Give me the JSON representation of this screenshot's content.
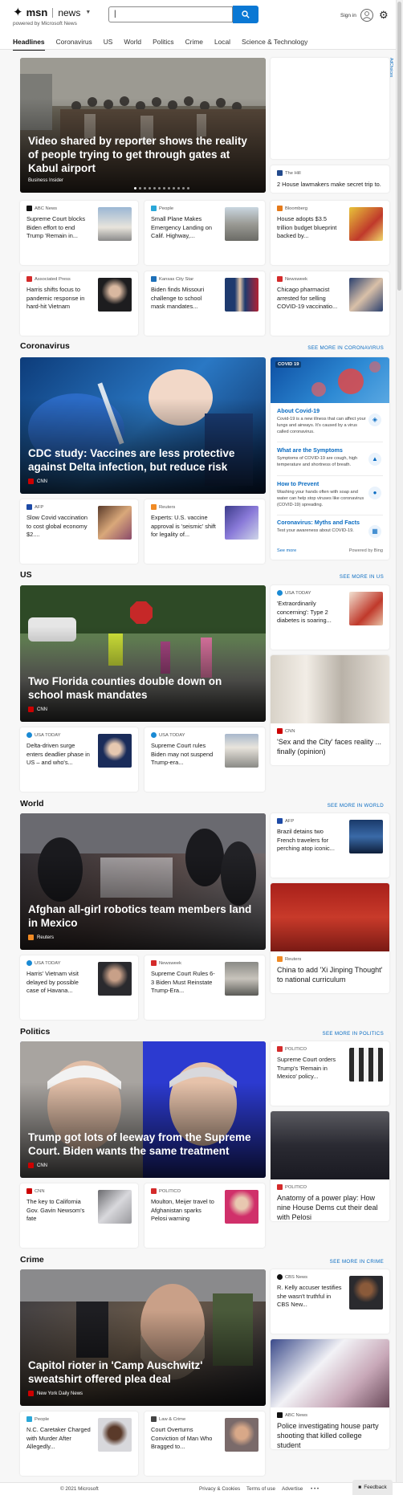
{
  "header": {
    "logo_msn": "msn",
    "logo_news": "news",
    "powered_by": "powered by Microsoft News",
    "search_value": "|",
    "signin_label": "Sign in"
  },
  "nav": [
    "Headlines",
    "Coronavirus",
    "US",
    "World",
    "Politics",
    "Crime",
    "Local",
    "Science & Technology"
  ],
  "adchoices": "AdChoices",
  "top": {
    "hero": {
      "title": "Video shared by reporter shows the reality of people trying to get through gates at Kabul airport",
      "source": "Business Insider"
    },
    "side": {
      "source": "The Hill",
      "title": "2 House lawmakers make secret trip to..."
    },
    "row1": [
      {
        "source": "ABC News",
        "title": "Supreme Court blocks Biden effort to end Trump 'Remain in..."
      },
      {
        "source": "People",
        "title": "Small Plane Makes Emergency Landing on Calif. Highway,..."
      },
      {
        "source": "Bloomberg",
        "title": "House adopts $3.5 trillion budget blueprint backed by..."
      }
    ],
    "row2": [
      {
        "source": "Associated Press",
        "title": "Harris shifts focus to pandemic response in hard-hit Vietnam"
      },
      {
        "source": "Kansas City Star",
        "title": "Biden finds Missouri challenge to school mask mandates..."
      },
      {
        "source": "Newsweek",
        "title": "Chicago pharmacist arrested for selling COVID-19 vaccinatio..."
      }
    ]
  },
  "coronavirus": {
    "title": "Coronavirus",
    "see_more": "SEE MORE IN CORONAVIRUS",
    "hero": {
      "title": "CDC study: Vaccines are less protective against Delta infection, but reduce risk",
      "source": "CNN"
    },
    "cards": [
      {
        "source": "AFP",
        "title": "Slow Covid vaccination to cost global economy $2...."
      },
      {
        "source": "Reuters",
        "title": "Experts: U.S. vaccine approval is 'seismic' shift for legality of..."
      }
    ],
    "module": {
      "tag": "COVID 19",
      "items": [
        {
          "title": "About Covid-19",
          "text": "Covid-19 is a new illness that can affect your lungs and airways. It's caused by a virus called coronavirus."
        },
        {
          "title": "What are the Symptoms",
          "text": "Symptoms of COVID-19 are cough, high temperature and shortness of breath."
        },
        {
          "title": "How to Prevent",
          "text": "Washing your hands often with soap and water can help stop viruses like coronavirus (COVID-19) spreading."
        },
        {
          "title": "Coronavirus: Myths and Facts",
          "text": "Test your awareness about COVID-19."
        }
      ],
      "see_more": "See more",
      "powered": "Powered by Bing"
    }
  },
  "us": {
    "title": "US",
    "see_more": "SEE MORE IN US",
    "hero": {
      "title": "Two Florida counties double down on school mask mandates",
      "source": "CNN"
    },
    "side": {
      "source": "USA TODAY",
      "title": "'Extraordinarily concerning': Type 2 diabetes is soaring..."
    },
    "tall": {
      "source": "CNN",
      "title": "'Sex and the City' faces reality ... finally (opinion)"
    },
    "cards": [
      {
        "source": "USA TODAY",
        "title": "Delta-driven surge enters deadlier phase in US – and who's..."
      },
      {
        "source": "USA TODAY",
        "title": "Supreme Court rules Biden may not suspend Trump-era..."
      }
    ]
  },
  "world": {
    "title": "World",
    "see_more": "SEE MORE IN WORLD",
    "hero": {
      "title": "Afghan all-girl robotics team members land in Mexico",
      "source": "Reuters"
    },
    "side": {
      "source": "AFP",
      "title": "Brazil detains two French travelers for perching atop iconic..."
    },
    "tall": {
      "source": "Reuters",
      "title": "China to add 'Xi Jinping Thought' to national curriculum"
    },
    "cards": [
      {
        "source": "USA TODAY",
        "title": "Harris' Vietnam visit delayed by possible case of Havana..."
      },
      {
        "source": "Newsweek",
        "title": "Supreme Court Rules 6-3 Biden Must Reinstate Trump-Era..."
      }
    ]
  },
  "politics": {
    "title": "Politics",
    "see_more": "SEE MORE IN POLITICS",
    "hero": {
      "title": "Trump got lots of leeway from the Supreme Court. Biden wants the same treatment",
      "source": "CNN"
    },
    "side": {
      "source": "POLITICO",
      "title": "Supreme Court orders Trump's 'Remain in Mexico' policy..."
    },
    "tall": {
      "source": "POLITICO",
      "title": "Anatomy of a power play: How nine House Dems cut their deal with Pelosi"
    },
    "cards": [
      {
        "source": "CNN",
        "title": "The key to California Gov. Gavin Newsom's fate"
      },
      {
        "source": "POLITICO",
        "title": "Moulton, Meijer travel to Afghanistan sparks Pelosi warning"
      }
    ]
  },
  "crime": {
    "title": "Crime",
    "see_more": "SEE MORE IN CRIME",
    "hero": {
      "title": "Capitol rioter in 'Camp Auschwitz' sweatshirt offered plea deal",
      "source": "New York Daily News"
    },
    "side": {
      "source": "CBS News",
      "title": "R. Kelly accuser testifies she wasn't truthful in CBS New..."
    },
    "tall": {
      "source": "ABC News",
      "title": "Police investigating house party shooting that killed college student"
    },
    "cards": [
      {
        "source": "People",
        "title": "N.C. Caretaker Charged with Murder After Allegedly..."
      },
      {
        "source": "Law & Crime",
        "title": "Court Overturns Conviction of Man Who Bragged to..."
      }
    ]
  },
  "footer": {
    "copyright": "© 2021 Microsoft",
    "privacy": "Privacy & Cookies",
    "terms": "Terms of use",
    "advertise": "Advertise",
    "more": "• • •",
    "feedback": "Feedback"
  }
}
